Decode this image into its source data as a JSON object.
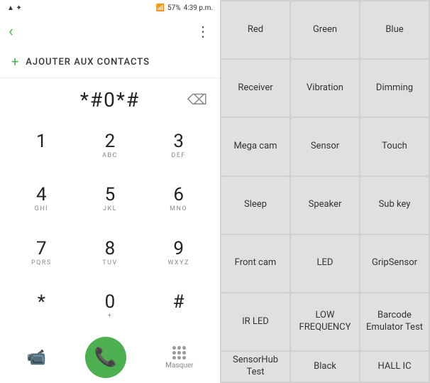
{
  "status": {
    "left_icons": "▲ ✦",
    "signal": "▌▌▌▌",
    "battery": "57%",
    "time": "4:39 p.m."
  },
  "top_bar": {
    "back_arrow": "‹",
    "dots": "⋮"
  },
  "add_contact": {
    "plus": "+",
    "label": "AJOUTER AUX CONTACTS"
  },
  "dialer": {
    "number": "*#0*#",
    "backspace": "⌫"
  },
  "keypad": [
    {
      "main": "1",
      "sub": ""
    },
    {
      "main": "2",
      "sub": "ABC"
    },
    {
      "main": "3",
      "sub": "DEF"
    },
    {
      "main": "4",
      "sub": "GHI"
    },
    {
      "main": "5",
      "sub": "JKL"
    },
    {
      "main": "6",
      "sub": "MNO"
    },
    {
      "main": "7",
      "sub": "PQRS"
    },
    {
      "main": "8",
      "sub": "TUV"
    },
    {
      "main": "9",
      "sub": "WXYZ"
    },
    {
      "main": "*",
      "sub": ""
    },
    {
      "main": "0",
      "sub": "+"
    },
    {
      "main": "#",
      "sub": ""
    }
  ],
  "bottom_bar": {
    "grid_label": "Masquer"
  },
  "right_panel": {
    "buttons": [
      "Red",
      "Green",
      "Blue",
      "Receiver",
      "Vibration",
      "Dimming",
      "Mega cam",
      "Sensor",
      "Touch",
      "Sleep",
      "Speaker",
      "Sub key",
      "Front cam",
      "LED",
      "GripSensor",
      "IR LED",
      "LOW\nFREQUENCY",
      "Barcode\nEmulator\nTest",
      "SensorHub\nTest",
      "Black",
      "HALL IC"
    ]
  }
}
